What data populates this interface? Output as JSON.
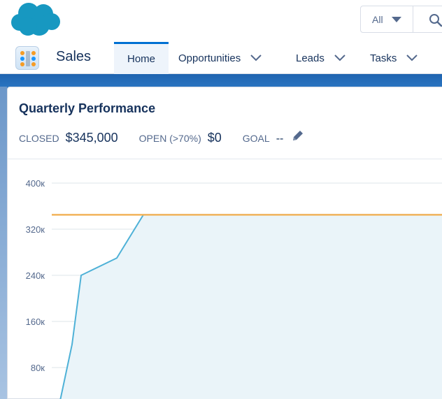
{
  "header": {
    "search_scope": "All",
    "icons": {
      "logo": "cloud-logo",
      "caret": "caret-down-icon",
      "search": "search-icon"
    },
    "logo_color": "#1798c1"
  },
  "nav": {
    "app_name": "Sales",
    "tabs": [
      {
        "label": "Home",
        "active": true,
        "has_menu": false
      },
      {
        "label": "Opportunities",
        "active": false,
        "has_menu": true
      },
      {
        "label": "Leads",
        "active": false,
        "has_menu": true
      },
      {
        "label": "Tasks",
        "active": false,
        "has_menu": true
      }
    ]
  },
  "card": {
    "title": "Quarterly Performance",
    "closed_label": "CLOSED",
    "closed_value": "$345,000",
    "open_label": "OPEN (>70%)",
    "open_value": "$0",
    "goal_label": "GOAL",
    "goal_value": "--",
    "edit_icon": "pencil-icon"
  },
  "chart_data": {
    "type": "area",
    "y_ticks": [
      "400к",
      "320к",
      "240к",
      "160к",
      "80к"
    ],
    "ylim": [
      0,
      400000
    ],
    "series": [
      {
        "x": [
          0,
          1,
          2,
          3,
          4,
          5,
          6
        ],
        "values": [
          0,
          120000,
          240000,
          270000,
          345000,
          345000,
          345000
        ]
      }
    ],
    "reference_line": 345000,
    "colors": {
      "line": "#4eb1d7",
      "fill": "#eaf4f9",
      "reference": "#f2b35a",
      "grid": "#dde4ea"
    }
  }
}
